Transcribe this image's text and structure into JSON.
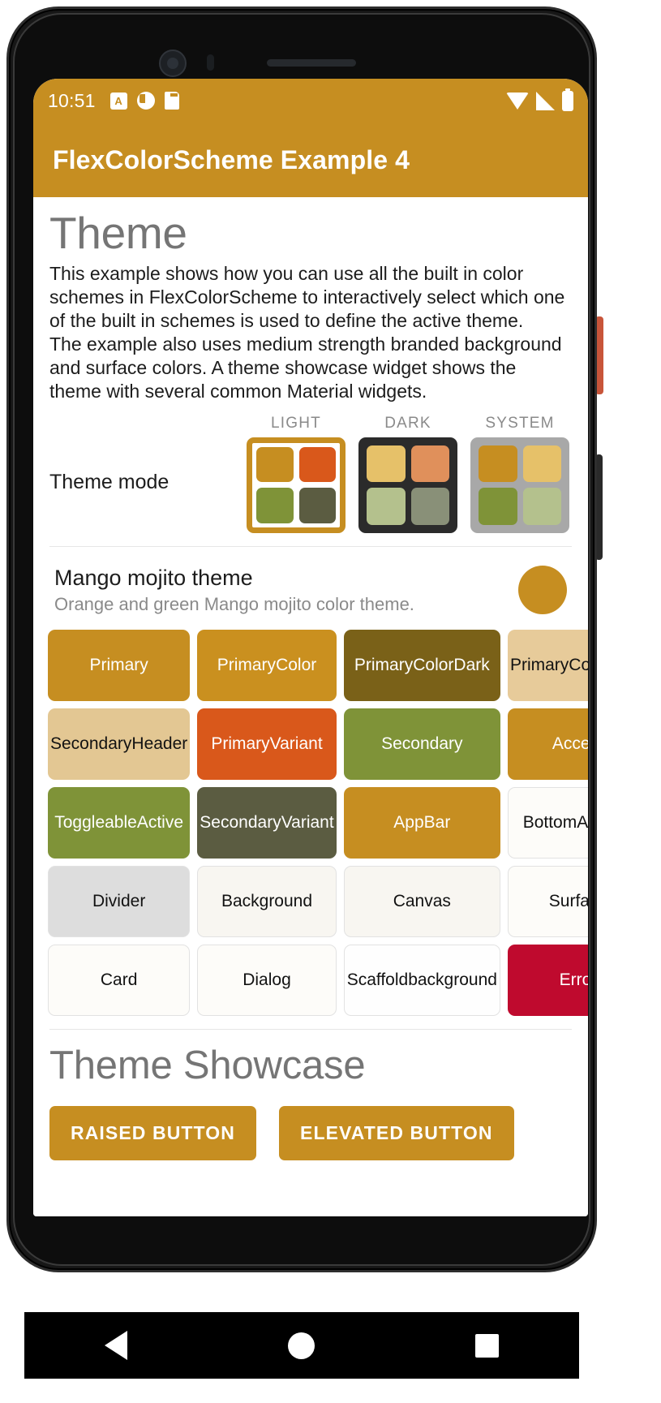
{
  "status_bar": {
    "time": "10:51",
    "left_icons": [
      "font-size-a-icon",
      "do-not-disturb-icon",
      "sd-card-icon"
    ],
    "right_icons": [
      "wifi-icon",
      "cellular-signal-icon",
      "battery-icon"
    ]
  },
  "app_bar": {
    "title": "FlexColorScheme Example 4",
    "background": "#c68e21",
    "text_color": "#ffffff"
  },
  "page": {
    "heading": "Theme",
    "description": "This example shows how you can use all the built in color schemes in FlexColorScheme to interactively select which one of the built in schemes is used to define the active theme.\nThe example also uses medium strength branded background and surface colors. A theme showcase widget shows the theme with several common Material widgets."
  },
  "theme_mode": {
    "label": "Theme mode",
    "selected": "LIGHT",
    "options": [
      {
        "label": "LIGHT",
        "selected": true,
        "box_background": "#ffffff",
        "border_color": "#c68e21",
        "swatches": [
          "#c68e21",
          "#d9581b",
          "#7f9338",
          "#5b5c41"
        ]
      },
      {
        "label": "DARK",
        "selected": false,
        "box_background": "#2b2b2b",
        "border_color": "#2b2b2b",
        "swatches": [
          "#e6c169",
          "#e0905b",
          "#b4c18d",
          "#899078"
        ]
      },
      {
        "label": "SYSTEM",
        "selected": false,
        "box_background": "#a8a8a8",
        "border_color": "#a8a8a8",
        "swatches": [
          "#c68e21",
          "#e6c169",
          "#7f9338",
          "#b4c18d"
        ]
      }
    ]
  },
  "scheme_card": {
    "title": "Mango mojito theme",
    "subtitle": "Orange and green Mango mojito color theme.",
    "indicator_color": "#c68e21",
    "colors": [
      {
        "label": "Primary",
        "bg": "#c68e21",
        "fg": "#ffffff",
        "bordered": false
      },
      {
        "label": "Primary\nColor",
        "bg": "#ca901f",
        "fg": "#ffffff",
        "bordered": false
      },
      {
        "label": "Primary\nColorDark",
        "bg": "#7a6118",
        "fg": "#ffffff",
        "bordered": false
      },
      {
        "label": "Primary\nColorLight",
        "bg": "#e7cb9a",
        "fg": "#121212",
        "bordered": false
      },
      {
        "label": "Secondary\nHeader",
        "bg": "#e3c793",
        "fg": "#121212",
        "bordered": false
      },
      {
        "label": "Primary\nVariant",
        "bg": "#d9581b",
        "fg": "#ffffff",
        "bordered": false
      },
      {
        "label": "Secondary",
        "bg": "#7f9338",
        "fg": "#ffffff",
        "bordered": false
      },
      {
        "label": "Accent",
        "bg": "#c68e21",
        "fg": "#ffffff",
        "bordered": false
      },
      {
        "label": "Toggleable\nActive",
        "bg": "#7f9338",
        "fg": "#ffffff",
        "bordered": false
      },
      {
        "label": "Secondary\nVariant",
        "bg": "#5b5c41",
        "fg": "#ffffff",
        "bordered": false
      },
      {
        "label": "AppBar",
        "bg": "#c68e21",
        "fg": "#ffffff",
        "bordered": false
      },
      {
        "label": "Bottom\nAppBar",
        "bg": "#fdfcf9",
        "fg": "#121212",
        "bordered": true
      },
      {
        "label": "Divider",
        "bg": "#dddddd",
        "fg": "#121212",
        "bordered": true
      },
      {
        "label": "Background",
        "bg": "#f8f6f1",
        "fg": "#121212",
        "bordered": true
      },
      {
        "label": "Canvas",
        "bg": "#f8f6f1",
        "fg": "#121212",
        "bordered": true
      },
      {
        "label": "Surface",
        "bg": "#fdfcf9",
        "fg": "#121212",
        "bordered": true
      },
      {
        "label": "Card",
        "bg": "#fdfcf9",
        "fg": "#121212",
        "bordered": true
      },
      {
        "label": "Dialog",
        "bg": "#fdfcf9",
        "fg": "#121212",
        "bordered": true
      },
      {
        "label": "Scaffold\nbackground",
        "bg": "#fefefe",
        "fg": "#121212",
        "bordered": true
      },
      {
        "label": "Error",
        "bg": "#bf0a2e",
        "fg": "#ffffff",
        "bordered": false
      }
    ]
  },
  "showcase": {
    "heading": "Theme Showcase",
    "buttons": [
      {
        "label": "RAISED BUTTON"
      },
      {
        "label": "ELEVATED BUTTON"
      }
    ]
  },
  "nav_bar": {
    "items": [
      "back-icon",
      "home-icon",
      "recents-icon"
    ]
  }
}
